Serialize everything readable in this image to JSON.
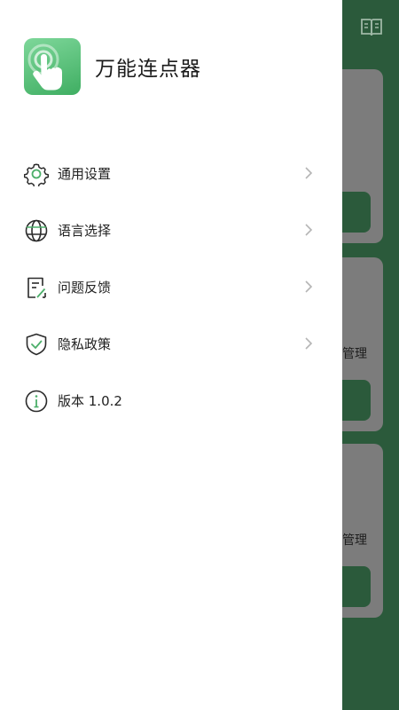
{
  "app": {
    "title": "万能连点器"
  },
  "menu": {
    "items": [
      {
        "label": "通用设置",
        "icon": "gear-icon",
        "has_chevron": true
      },
      {
        "label": "语言选择",
        "icon": "globe-icon",
        "has_chevron": true
      },
      {
        "label": "问题反馈",
        "icon": "feedback-icon",
        "has_chevron": true
      },
      {
        "label": "隐私政策",
        "icon": "shield-check-icon",
        "has_chevron": true
      },
      {
        "label": "版本 1.0.2",
        "icon": "info-icon",
        "has_chevron": false
      }
    ]
  },
  "background": {
    "card_labels": [
      "管理",
      "管理"
    ]
  },
  "colors": {
    "primary_green": "#2b5a3b",
    "accent_green": "#4caf6a",
    "card_gray": "#7c7c7c"
  }
}
